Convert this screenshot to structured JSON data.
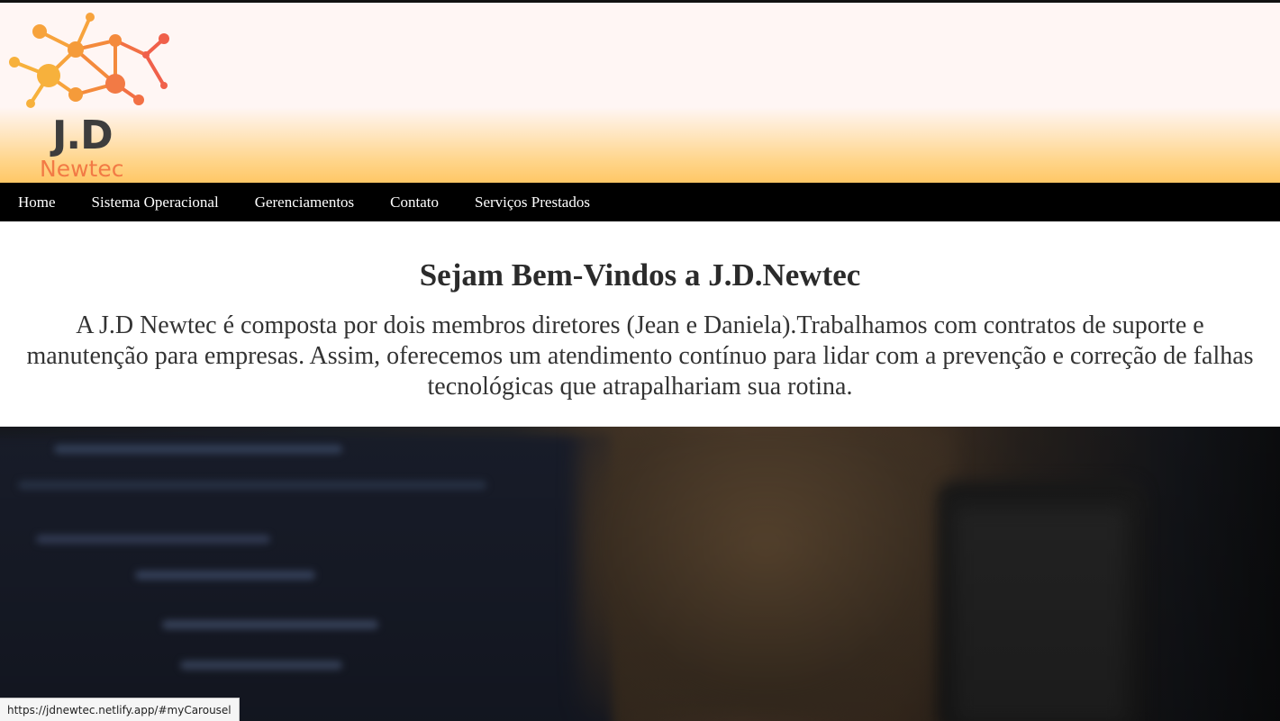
{
  "brand": {
    "title": "J.D",
    "subtitle": "Newtec",
    "title_color": "#3d3d3d",
    "subtitle_color": "#f27a45",
    "icon": "molecule-network-icon"
  },
  "nav": {
    "items": [
      {
        "label": "Home"
      },
      {
        "label": "Sistema Operacional"
      },
      {
        "label": "Gerenciamentos"
      },
      {
        "label": "Contato"
      },
      {
        "label": "Serviços Prestados"
      }
    ]
  },
  "intro": {
    "heading": "Sejam Bem-Vindos a J.D.Newtec",
    "text": "A J.D Newtec é composta por dois membros diretores (Jean e Daniela).Trabalhamos com contratos de suporte e manutenção para empresas. Assim, oferecemos um atendimento contínuo para lidar com a prevenção e correção de falhas tecnológicas que atrapalhariam sua rotina."
  },
  "carousel": {
    "image": "blurred-laptop-and-mug-photo"
  },
  "status_bar": {
    "url": "https://jdnewtec.netlify.app/#myCarousel"
  },
  "colors": {
    "nav_bg": "#000000",
    "header_gradient_end": "#ffc766"
  }
}
